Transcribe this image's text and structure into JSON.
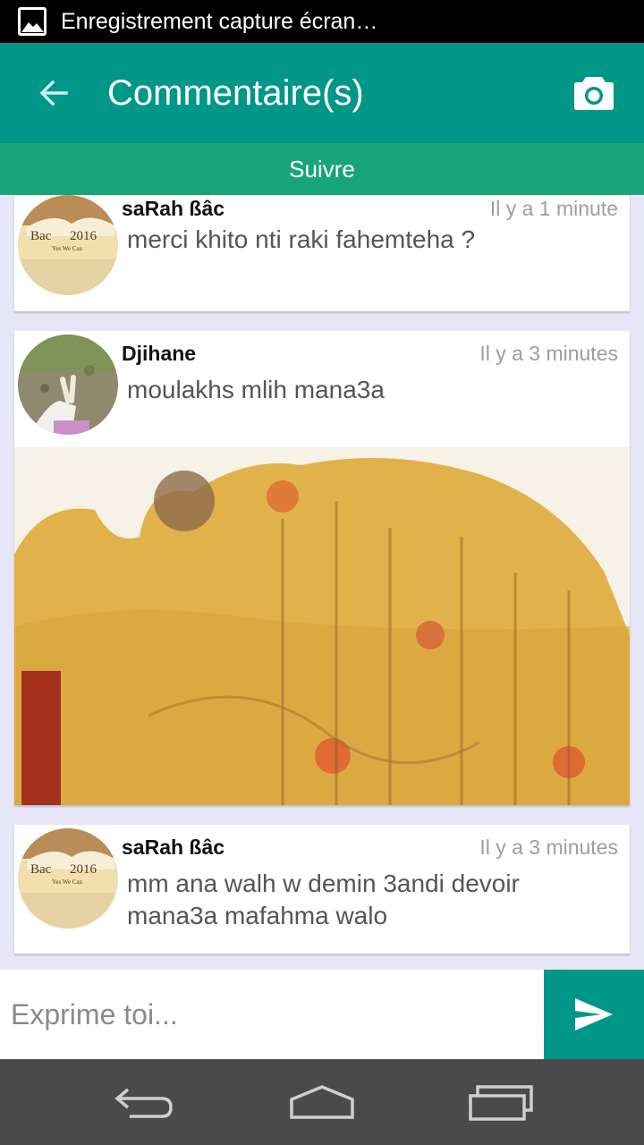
{
  "status_bar": {
    "notification_icon": "image-icon",
    "notification_text": "Enregistrement capture écran…"
  },
  "app_bar": {
    "title": "Commentaire(s)",
    "back_icon": "arrow-left-icon",
    "action_icon": "camera-icon"
  },
  "follow_bar": {
    "label": "Suivre"
  },
  "comments": [
    {
      "author": "saRah ßâc",
      "time": "Il y a 1 minute",
      "text": "merci khito nti raki fahemteha ?",
      "avatar_text": {
        "line1": "Bac",
        "year": "2016",
        "tagline": "Yes We Can"
      }
    },
    {
      "author": "Djihane",
      "time": "Il y a 3 minutes",
      "text": "moulakhs mlih mana3a"
    },
    {
      "author": "saRah ßâc",
      "time": "Il y a 3 minutes",
      "text": "mm ana walh w demin 3andi devoir mana3a mafahma walo",
      "avatar_text": {
        "line1": "Bac",
        "year": "2016",
        "tagline": "Yes We Can"
      }
    }
  ],
  "composer": {
    "placeholder": "Exprime toi...",
    "send_icon": "send-icon"
  },
  "nav_bar": {
    "icons": [
      "back-icon",
      "home-icon",
      "recents-icon"
    ]
  },
  "colors": {
    "primary": "#009688",
    "follow_bar": "#19a57a",
    "feed_background": "#e6e6f7"
  }
}
